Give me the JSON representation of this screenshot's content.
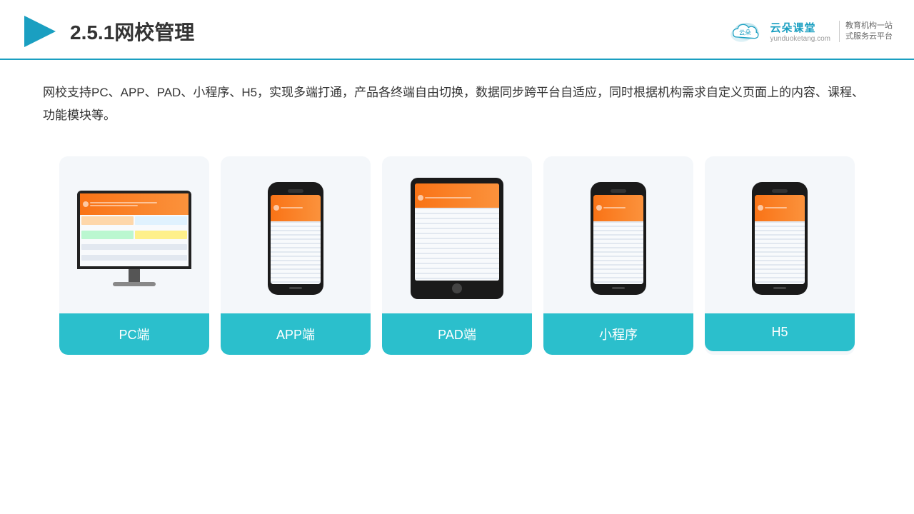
{
  "header": {
    "title": "2.5.1网校管理",
    "logo": {
      "name": "云朵课堂",
      "domain": "yunduoketang.com",
      "slogan": "教育机构一站\n式服务云平台"
    }
  },
  "description": {
    "text": "网校支持PC、APP、PAD、小程序、H5，实现多端打通，产品各终端自由切换，数据同步跨平台自适应，同时根据机构需求自定义页面上的内容、课程、功能模块等。"
  },
  "cards": [
    {
      "id": "pc",
      "label": "PC端",
      "type": "pc"
    },
    {
      "id": "app",
      "label": "APP端",
      "type": "phone"
    },
    {
      "id": "pad",
      "label": "PAD端",
      "type": "tablet"
    },
    {
      "id": "miniprogram",
      "label": "小程序",
      "type": "phone"
    },
    {
      "id": "h5",
      "label": "H5",
      "type": "phone"
    }
  ],
  "colors": {
    "accent": "#2bbfcc",
    "headerBorder": "#1a9fc1",
    "titleColor": "#333333",
    "textColor": "#333333"
  }
}
